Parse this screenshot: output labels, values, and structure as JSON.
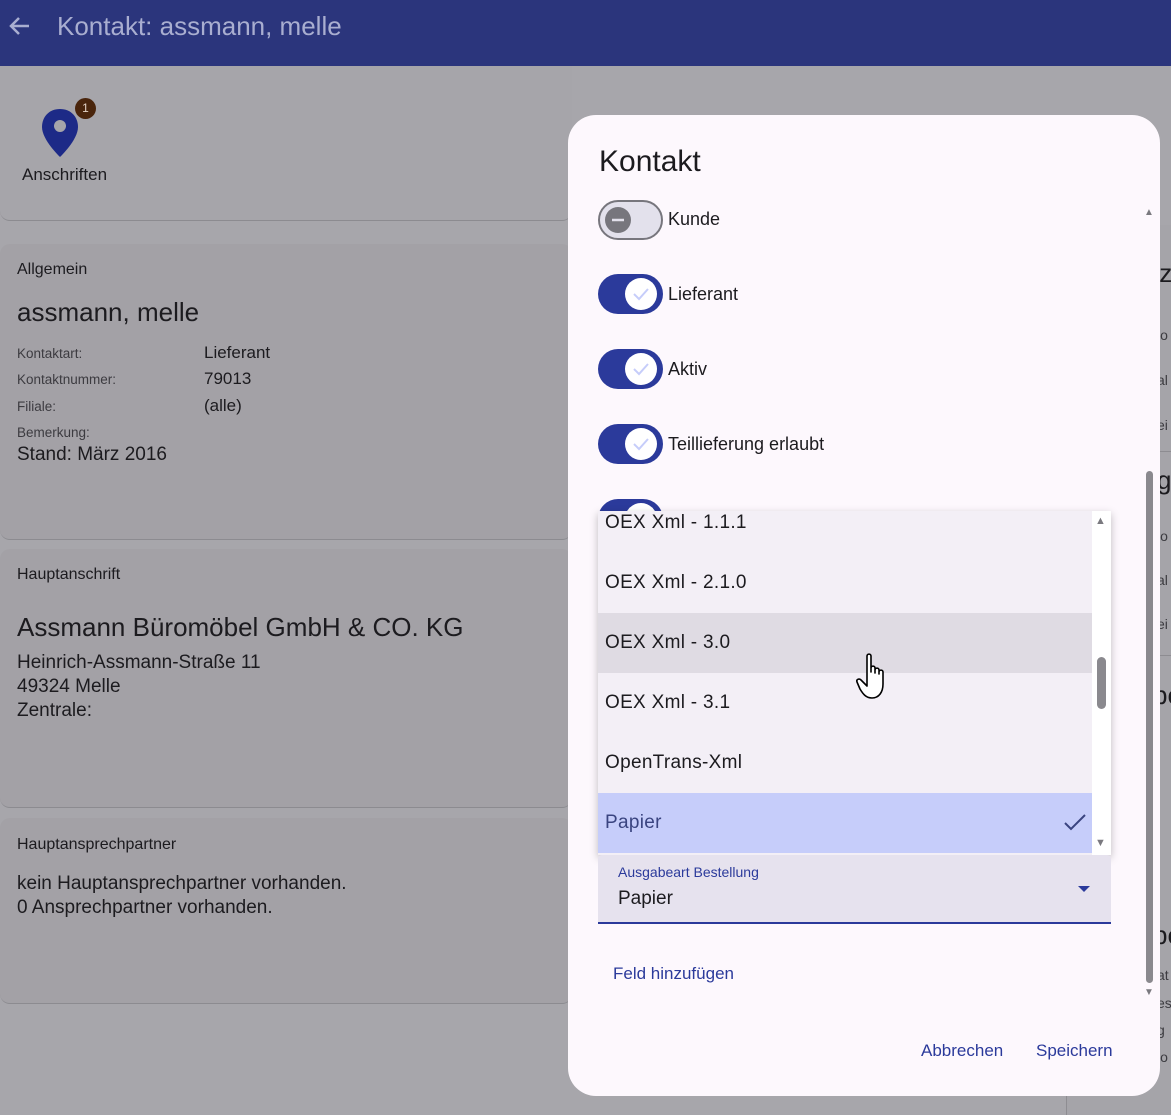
{
  "appbar": {
    "title": "Kontakt: assmann, melle",
    "back_icon": "arrow-left-icon"
  },
  "top_card": {
    "badge_count": "1",
    "anschriften_label": "Anschriften"
  },
  "general": {
    "header": "Allgemein",
    "name": "assmann, melle",
    "fields": [
      {
        "label": "Kontaktart:",
        "value": "Lieferant"
      },
      {
        "label": "Kontaktnummer:",
        "value": "79013"
      },
      {
        "label": "Filiale:",
        "value": "(alle)"
      },
      {
        "label": "Bemerkung:",
        "value": ""
      }
    ],
    "note": "Stand: März 2016"
  },
  "address": {
    "header": "Hauptanschrift",
    "company": "Assmann Büromöbel GmbH & CO. KG",
    "street": "Heinrich-Assmann-Straße 11",
    "city": "49324 Melle",
    "type": "Zentrale:"
  },
  "contact_person": {
    "header": "Hauptansprechpartner",
    "line1": "kein Hauptansprechpartner vorhanden.",
    "line2": "0 Ansprechpartner vorhanden."
  },
  "right_peek": {
    "t1": "tz",
    "s1": "lo",
    "s2": "al",
    "s3": "ei",
    "t2": "g",
    "s4": "lo",
    "s5": "al",
    "s6": "ei",
    "t3": "be",
    "t4": "pe",
    "s7": "at",
    "s8": "es",
    "s9": "g",
    "s10": "lo"
  },
  "dialog": {
    "title": "Kontakt",
    "switches": [
      {
        "label": "Kunde",
        "on": false
      },
      {
        "label": "Lieferant",
        "on": true
      },
      {
        "label": "Aktiv",
        "on": true
      },
      {
        "label": "Teillieferung erlaubt",
        "on": true
      }
    ],
    "dropdown_items": [
      {
        "label": "OEX Xml - 1.1.1"
      },
      {
        "label": "OEX Xml - 2.1.0"
      },
      {
        "label": "OEX Xml - 3.0",
        "state": "hover"
      },
      {
        "label": "OEX Xml - 3.1"
      },
      {
        "label": "OpenTrans-Xml"
      },
      {
        "label": "Papier",
        "state": "selected"
      }
    ],
    "select": {
      "label": "Ausgabeart Bestellung",
      "value": "Papier"
    },
    "add_field_label": "Feld hinzufügen",
    "cancel_label": "Abbrechen",
    "save_label": "Speichern"
  },
  "colors": {
    "primary": "#2b357c",
    "accent": "#2b3a9b",
    "selected_bg": "#c6cdfa",
    "badge": "#4a250c"
  }
}
